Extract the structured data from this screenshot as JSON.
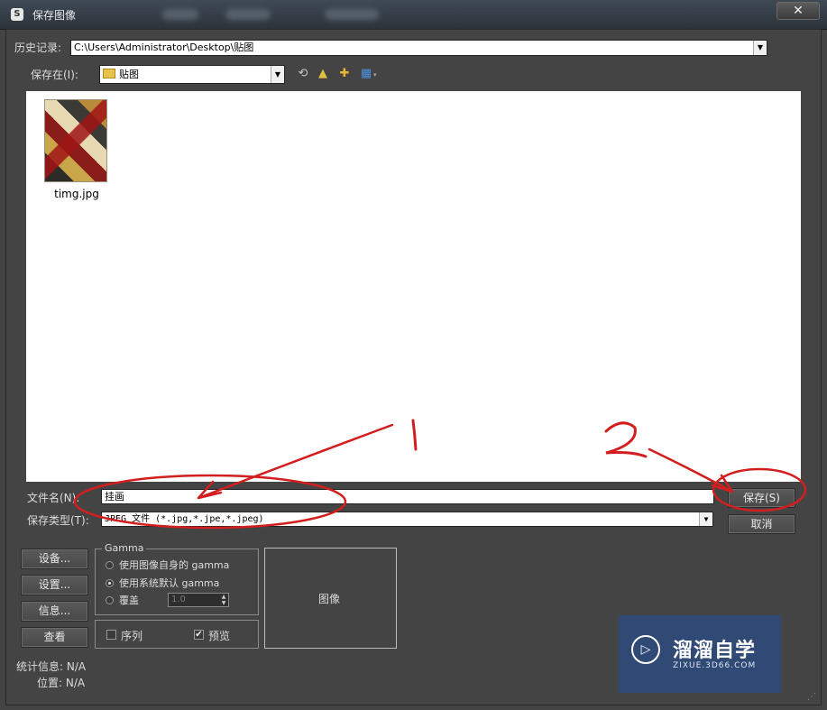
{
  "window": {
    "title": "保存图像",
    "app_icon": "3ds-max-logo-icon",
    "close_glyph": "✕"
  },
  "history": {
    "label": "历史记录:",
    "value": "C:\\Users\\Administrator\\Desktop\\贴图"
  },
  "save_in": {
    "label": "保存在(I):",
    "value": "贴图",
    "folder_icon": "folder-icon",
    "tools": [
      "back-icon",
      "up-folder-icon",
      "new-folder-icon",
      "view-menu-icon"
    ]
  },
  "files": [
    {
      "name": "timg.jpg",
      "icon": "image-thumbnail"
    }
  ],
  "filename": {
    "label": "文件名(N):",
    "value": "挂画"
  },
  "filetype": {
    "label": "保存类型(T):",
    "value": "JPEG 文件 (*.jpg,*.jpe,*.jpeg)"
  },
  "buttons": {
    "save": "保存(S)",
    "cancel": "取消",
    "devices": "设备...",
    "setup": "设置...",
    "info": "信息...",
    "view": "查看"
  },
  "gamma": {
    "title": "Gamma",
    "options": [
      {
        "label": "使用图像自身的 gamma",
        "selected": false
      },
      {
        "label": "使用系统默认 gamma",
        "selected": true
      },
      {
        "label": "覆盖",
        "selected": false
      }
    ],
    "override_value": "1.0"
  },
  "options": {
    "sequence_label": "序列",
    "sequence_checked": false,
    "preview_label": "预览",
    "preview_checked": true
  },
  "preview": {
    "label": "图像"
  },
  "stats": {
    "label": "统计信息: N/A",
    "location": "位置: N/A"
  },
  "annotations": {
    "step1": "1",
    "step2": "2",
    "color": "#d21e1e"
  },
  "watermark": {
    "title": "溜溜自学",
    "subtitle": "ZIXUE.3D66.COM",
    "logo_icon": "play-icon"
  }
}
